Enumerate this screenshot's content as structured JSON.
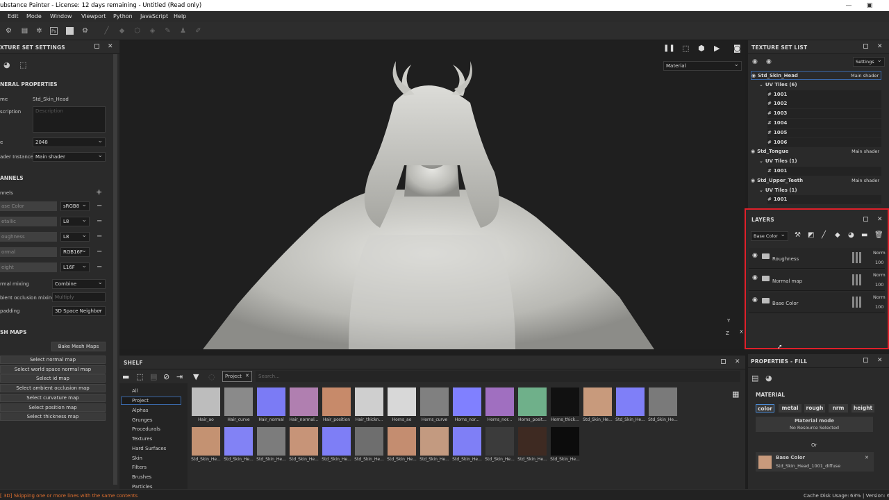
{
  "window": {
    "title": "ubstance Painter - License: 12 days remaining - Untitled (Read only)",
    "minimize": "—",
    "restore": "▣"
  },
  "menu": [
    "Edit",
    "Mode",
    "Window",
    "Viewport",
    "Python",
    "JavaScript",
    "Help"
  ],
  "toolbar_icons": [
    "gear-icon",
    "trash-icon",
    "settings-icon",
    "photoshop-icon",
    "document-icon",
    "gear-icon",
    "brush-icon",
    "eraser-icon",
    "projection-icon",
    "geometry-icon",
    "smudge-icon",
    "clone-icon",
    "picker-icon"
  ],
  "texture_set_settings": {
    "title": "XTURE SET SETTINGS",
    "general": "NERAL PROPERTIES",
    "name_label": "me",
    "name_value": "Std_Skin_Head",
    "desc_label": "scription",
    "desc_placeholder": "Description",
    "size_label": "e",
    "size_value": "2048",
    "shader_label": "ader Instance",
    "shader_value": "Main shader",
    "channels_title": "ANNELS",
    "channels_label": "nnels",
    "channels": [
      {
        "name": "ase Color",
        "format": "sRGB8"
      },
      {
        "name": "etallic",
        "format": "L8"
      },
      {
        "name": "oughness",
        "format": "L8"
      },
      {
        "name": "ormal",
        "format": "RGB16F"
      },
      {
        "name": "eight",
        "format": "L16F"
      }
    ],
    "normal_mixing_label": "rmal mixing",
    "normal_mixing_value": "Combine",
    "ao_mixing_label": "bient occlusion mixing",
    "ao_mixing_value": "Multiply",
    "padding_label": "padding",
    "padding_value": "3D Space Neighbor",
    "mesh_maps_title": "SH MAPS",
    "bake_button": "Bake Mesh Maps",
    "select_buttons": [
      "Select normal map",
      "Select world space normal map",
      "Select id map",
      "Select ambient occlusion map",
      "Select curvature map",
      "Select position map",
      "Select thickness map"
    ]
  },
  "viewport": {
    "display_mode": "Material",
    "axis_y": "Y",
    "axis_x": "X",
    "axis_z": "Z"
  },
  "shelf": {
    "title": "SHELF",
    "filter_tag": "Project",
    "search_placeholder": "Search...",
    "categories": [
      "All",
      "Project",
      "Alphas",
      "Grunges",
      "Procedurals",
      "Textures",
      "Hard Surfaces",
      "Skin",
      "Filters",
      "Brushes",
      "Particles"
    ],
    "selected_category": "Project",
    "thumbs": [
      {
        "label": "Hair_ao",
        "color": "#bdbdbd"
      },
      {
        "label": "Hair_curve",
        "color": "#8a8a8a"
      },
      {
        "label": "Hair_normal",
        "color": "#7b7bf5"
      },
      {
        "label": "Hair_normal...",
        "color": "#b07fb0"
      },
      {
        "label": "Hair_position",
        "color": "#c78a6a"
      },
      {
        "label": "Hair_thickn...",
        "color": "#cfcfcf"
      },
      {
        "label": "Horns_ao",
        "color": "#d8d8d8"
      },
      {
        "label": "Horns_curve",
        "color": "#808080"
      },
      {
        "label": "Horns_nor...",
        "color": "#8080ff"
      },
      {
        "label": "Horns_nor...",
        "color": "#a06fc0"
      },
      {
        "label": "Horns_posit...",
        "color": "#6fb08a"
      },
      {
        "label": "Horns_thick...",
        "color": "#111111"
      },
      {
        "label": "Std_Skin_He...",
        "color": "#c89a7c"
      },
      {
        "label": "Std_Skin_He...",
        "color": "#7f7ff8"
      },
      {
        "label": "Std_Skin_He...",
        "color": "#7a7a7a"
      },
      {
        "label": "Std_Skin_He...",
        "color": "#c49272"
      },
      {
        "label": "Std_Skin_He...",
        "color": "#8282f5"
      },
      {
        "label": "Std_Skin_He...",
        "color": "#7c7c7c"
      },
      {
        "label": "Std_Skin_He...",
        "color": "#c79478"
      },
      {
        "label": "Std_Skin_He...",
        "color": "#7e7ef6"
      },
      {
        "label": "Std_Skin_He...",
        "color": "#6e6e6e"
      },
      {
        "label": "Std_Skin_He...",
        "color": "#c48d70"
      },
      {
        "label": "Std_Skin_He...",
        "color": "#c39a80"
      },
      {
        "label": "Std_Skin_He...",
        "color": "#7f7ff6"
      },
      {
        "label": "Std_Skin_He...",
        "color": "#3b3b3b"
      },
      {
        "label": "Std_Skin_He...",
        "color": "#3e2a22"
      },
      {
        "label": "Std_Skin_He...",
        "color": "#0c0c0c"
      }
    ]
  },
  "texture_set_list": {
    "title": "TEXTURE SET LIST",
    "settings": "Settings",
    "rows": [
      {
        "label": "Std_Skin_Head",
        "shader": "Main shader",
        "level": 0,
        "selected": true
      },
      {
        "label": "UV Tiles (6)",
        "level": 1
      },
      {
        "label": "1001",
        "level": 2
      },
      {
        "label": "1002",
        "level": 2
      },
      {
        "label": "1003",
        "level": 2
      },
      {
        "label": "1004",
        "level": 2
      },
      {
        "label": "1005",
        "level": 2
      },
      {
        "label": "1006",
        "level": 2
      },
      {
        "label": "Std_Tongue",
        "shader": "Main shader",
        "level": 0
      },
      {
        "label": "UV Tiles (1)",
        "level": 1
      },
      {
        "label": "1001",
        "level": 2
      },
      {
        "label": "Std_Upper_Teeth",
        "shader": "Main shader",
        "level": 0
      },
      {
        "label": "UV Tiles (1)",
        "level": 1
      },
      {
        "label": "1001",
        "level": 2
      }
    ]
  },
  "layers": {
    "title": "LAYERS",
    "channel": "Base Color",
    "items": [
      {
        "name": "Roughness",
        "blend": "Norm",
        "opacity": "100"
      },
      {
        "name": "Normal map",
        "blend": "Norm",
        "opacity": "100"
      },
      {
        "name": "Base Color",
        "blend": "Norm",
        "opacity": "100"
      }
    ],
    "highlight": "#e0202a"
  },
  "properties": {
    "title": "PROPERTIES - FILL",
    "material_title": "MATERIAL",
    "tabs": [
      "color",
      "metal",
      "rough",
      "nrm",
      "height"
    ],
    "active_tab": "color",
    "material_mode": "Material mode",
    "no_resource": "No Resource Selected",
    "or": "Or",
    "base_color_label": "Base Color",
    "base_color_value": "Std_Skin_Head_1001_diffuse"
  },
  "status": {
    "message": "[ 3D] Skipping one or more lines with the same contents",
    "cache": "Cache Disk Usage:",
    "cache_value": "63%",
    "version": "| Version: 6"
  }
}
